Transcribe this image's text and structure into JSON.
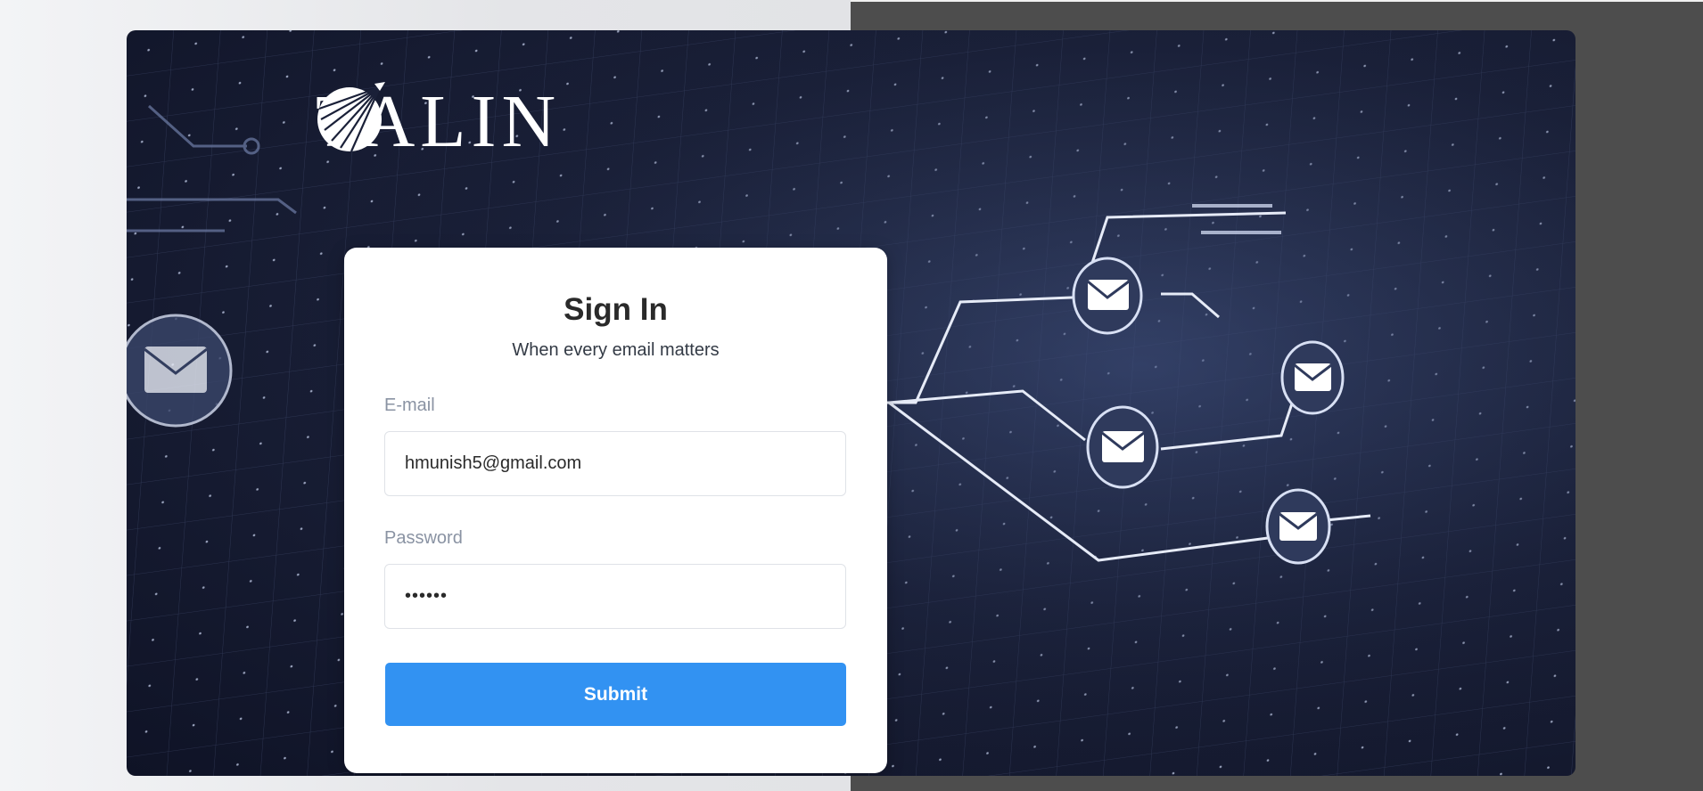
{
  "brand": {
    "name": "TALIN",
    "logo_icon": "talin-globe-icon"
  },
  "signin": {
    "title": "Sign In",
    "subtitle": "When every email matters",
    "email_label": "E-mail",
    "email_value": "hmunish5@gmail.com",
    "password_label": "Password",
    "password_value": "••••••",
    "submit_label": "Submit"
  },
  "hero": {
    "image": "email-network-background",
    "icons": [
      "envelope-icon"
    ]
  },
  "colors": {
    "accent": "#3292f2",
    "hero_bg": "#1a2038",
    "card_bg": "#ffffff",
    "label": "#8a93a3"
  }
}
